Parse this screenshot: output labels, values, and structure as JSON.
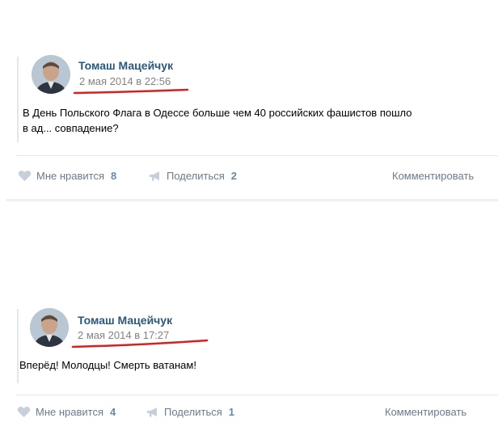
{
  "posts": [
    {
      "author": "Томаш Мацейчук",
      "date": "2 мая 2014 в 22:56",
      "text_line1": "В День Польского Флага в Одессе больше чем 40 российских фашистов пошло",
      "text_line2": "в ад... совпадение?",
      "like_label": "Мне нравится",
      "like_count": "8",
      "share_label": "Поделиться",
      "share_count": "2",
      "comment_label": "Комментировать"
    },
    {
      "author": "Томаш Мацейчук",
      "date": "2 мая 2014 в 17:27",
      "text_line1": "Вперёд! Молодцы! Смерть ватанам!",
      "like_label": "Мне нравится",
      "like_count": "4",
      "share_label": "Поделиться",
      "share_count": "1",
      "comment_label": "Комментировать"
    }
  ],
  "colors": {
    "author": "#2b587a",
    "date": "#828282",
    "action": "#6b7a8c",
    "underline": "#d9201d"
  },
  "icons": {
    "like": "heart-icon",
    "share": "megaphone-icon"
  }
}
